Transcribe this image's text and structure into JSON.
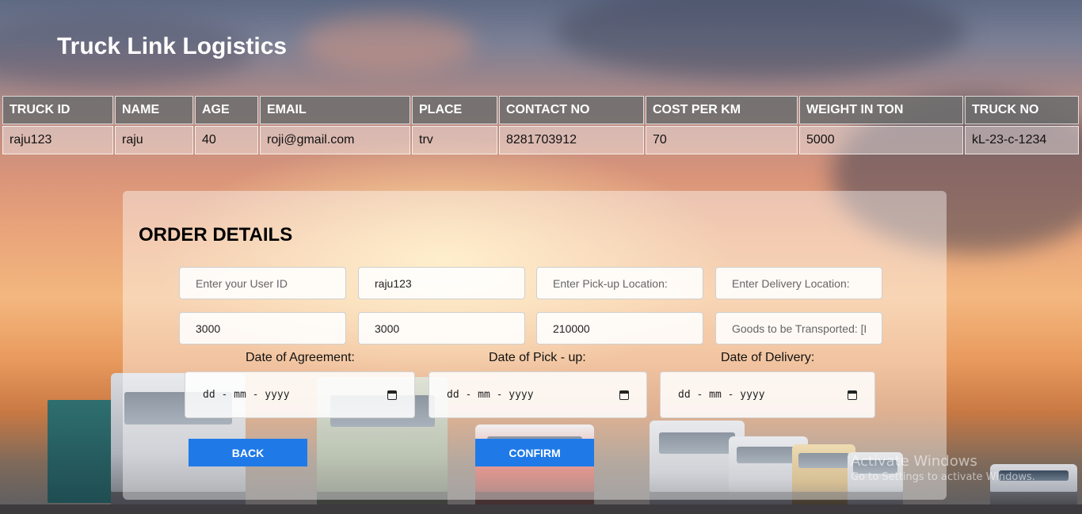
{
  "header": {
    "title": "Truck Link Logistics"
  },
  "truck_table": {
    "columns": [
      "TRUCK ID",
      "NAME",
      "AGE",
      "EMAIL",
      "PLACE",
      "CONTACT NO",
      "COST PER KM",
      "WEIGHT IN TON",
      "TRUCK NO"
    ],
    "rows": [
      [
        "raju123",
        "raju",
        "40",
        "roji@gmail.com",
        "trv",
        "8281703912",
        "70",
        "5000",
        "kL-23-c-1234"
      ]
    ]
  },
  "order": {
    "title": "ORDER DETAILS",
    "fields": {
      "user_id": {
        "placeholder": "Enter your User ID",
        "value": ""
      },
      "truck_id": {
        "placeholder": "",
        "value": "raju123"
      },
      "pickup": {
        "placeholder": "Enter Pick-up Location:",
        "value": ""
      },
      "delivery": {
        "placeholder": "Enter Delivery Location:",
        "value": ""
      },
      "distance": {
        "placeholder": "",
        "value": "3000"
      },
      "weight": {
        "placeholder": "",
        "value": "3000"
      },
      "cost": {
        "placeholder": "",
        "value": "210000"
      },
      "goods": {
        "placeholder": "Goods to be Transported: [De",
        "value": ""
      }
    },
    "dates": {
      "agreement": {
        "label": "Date of Agreement:",
        "value": "dd - mm - yyyy"
      },
      "pickup": {
        "label": "Date of Pick - up:",
        "value": "dd - mm - yyyy"
      },
      "delivery": {
        "label": "Date of Delivery:",
        "value": "dd - mm - yyyy"
      }
    },
    "buttons": {
      "back": "BACK",
      "confirm": "CONFIRM"
    },
    "colors": {
      "button": "#1f7ae8"
    }
  },
  "watermark": {
    "line1": "Activate Windows",
    "line2": "Go to Settings to activate Windows."
  }
}
